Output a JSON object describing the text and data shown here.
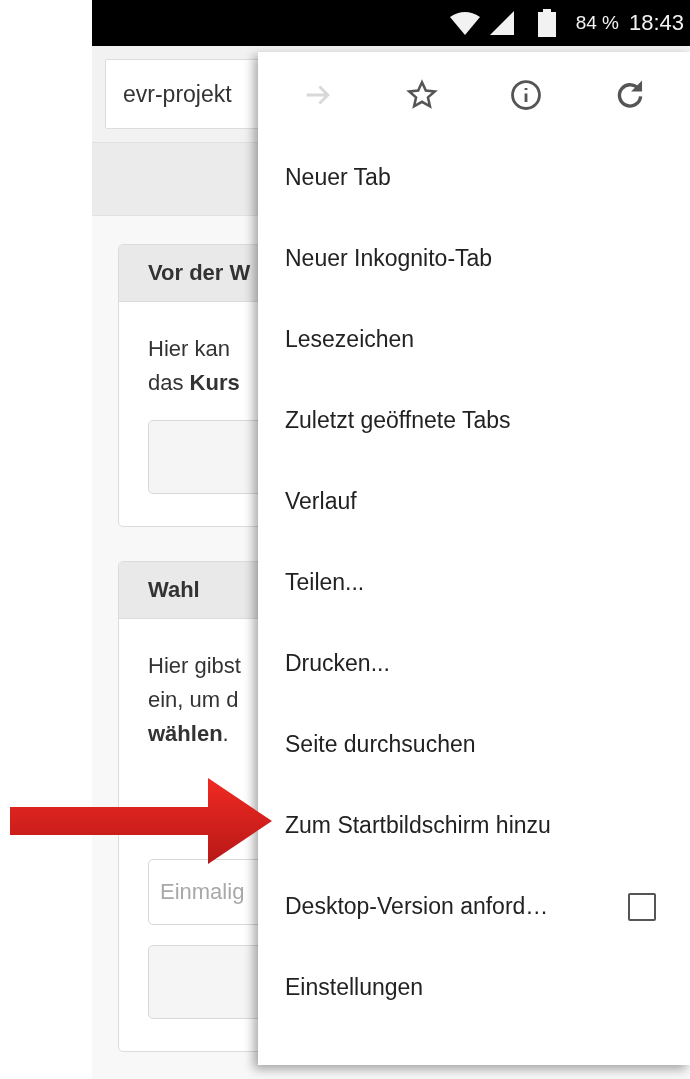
{
  "status_bar": {
    "battery": "84 %",
    "time": "18:43"
  },
  "address_bar": {
    "value": "evr-projekt"
  },
  "cards": [
    {
      "title": "Vor der W",
      "lines": [
        "Hier kan",
        "das **Kurs**"
      ],
      "controls": [
        {
          "kind": "button"
        }
      ]
    },
    {
      "title": "Wahl",
      "lines": [
        "Hier gibst",
        "ein, um d",
        "**wählen**."
      ],
      "controls": [
        {
          "kind": "input",
          "placeholder": "Einmalig"
        },
        {
          "kind": "button"
        }
      ]
    }
  ],
  "menu": {
    "toolbar": [
      {
        "kind": "forward",
        "disabled": true
      },
      {
        "kind": "bookmark",
        "disabled": false
      },
      {
        "kind": "info",
        "disabled": false
      },
      {
        "kind": "reload",
        "disabled": false
      }
    ],
    "items": [
      {
        "kind": "plain",
        "label": "Neuer Tab"
      },
      {
        "kind": "plain",
        "label": "Neuer Inkognito-Tab"
      },
      {
        "kind": "plain",
        "label": "Lesezeichen"
      },
      {
        "kind": "plain",
        "label": "Zuletzt geöffnete Tabs"
      },
      {
        "kind": "plain",
        "label": "Verlauf"
      },
      {
        "kind": "plain",
        "label": "Teilen..."
      },
      {
        "kind": "plain",
        "label": "Drucken..."
      },
      {
        "kind": "plain",
        "label": "Seite durchsuchen"
      },
      {
        "kind": "plain",
        "label": "Zum Startbildschirm hinzu"
      },
      {
        "kind": "checkbox",
        "label": "Desktop-Version anford…",
        "checked": false
      },
      {
        "kind": "plain",
        "label": "Einstellungen"
      }
    ]
  }
}
